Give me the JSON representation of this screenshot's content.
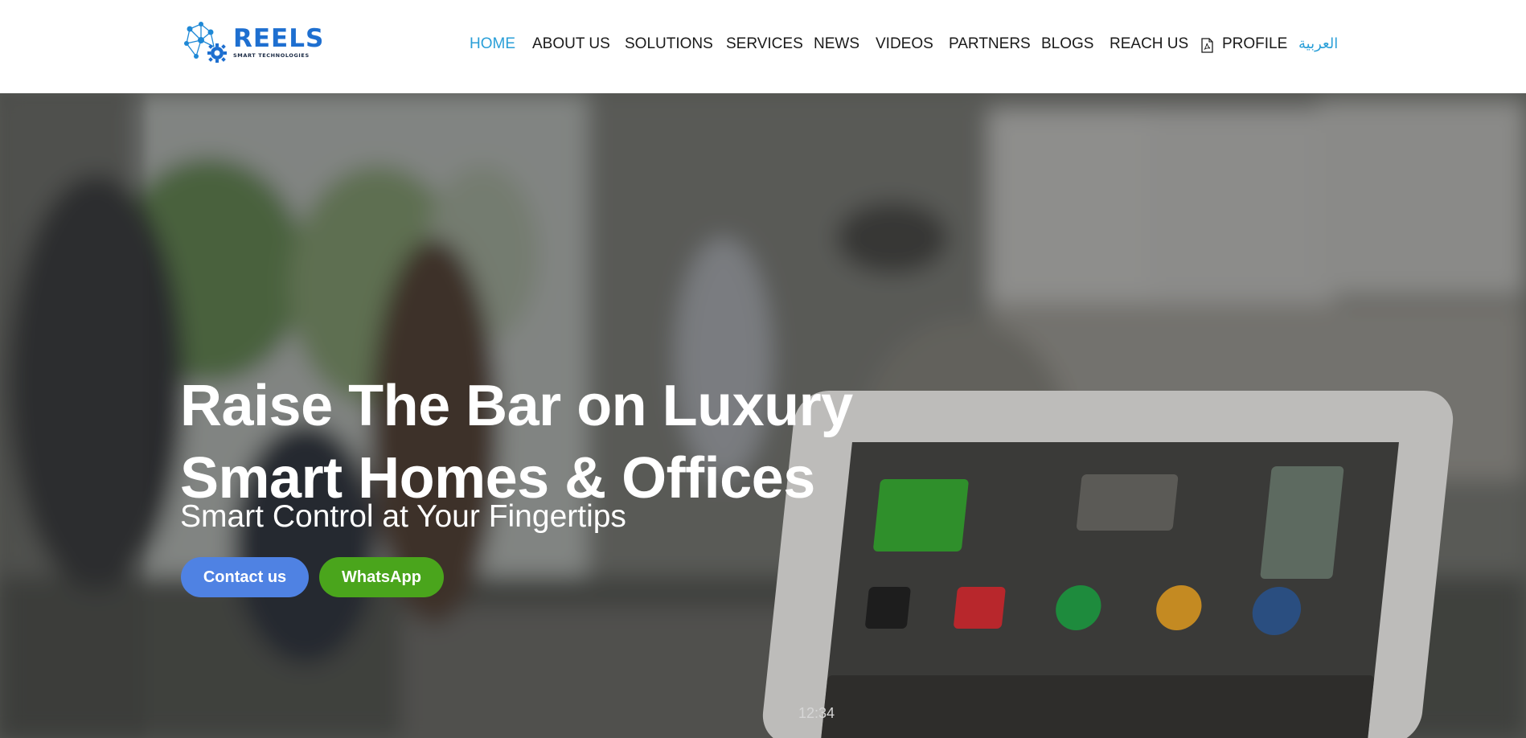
{
  "brand": {
    "name": "REELS",
    "tagline": "SMART TECHNOLOGIES",
    "accent": "#2a9fd8",
    "logo_blue": "#1e6fd0"
  },
  "nav": {
    "items": [
      {
        "label": "HOME",
        "active": true
      },
      {
        "label": "ABOUT US"
      },
      {
        "label": "SOLUTIONS"
      },
      {
        "label": "SERVICES"
      },
      {
        "label": "NEWS"
      },
      {
        "label": "VIDEOS"
      },
      {
        "label": "PARTNERS"
      },
      {
        "label": "BLOGS"
      },
      {
        "label": "REACH US"
      },
      {
        "label": "PROFILE",
        "icon": "pdf-file-icon"
      },
      {
        "label": "العربية",
        "lang": true
      }
    ]
  },
  "hero": {
    "headline_line1": "Raise The Bar on Luxury",
    "headline_line2": "Smart Homes & Offices",
    "subheadline": "Smart Control at Your Fingertips",
    "buttons": {
      "contact": {
        "label": "Contact us",
        "color": "#4f82e3"
      },
      "whatsapp": {
        "label": "WhatsApp",
        "color": "#4aa51c"
      }
    },
    "tablet_clock": "12:34"
  }
}
